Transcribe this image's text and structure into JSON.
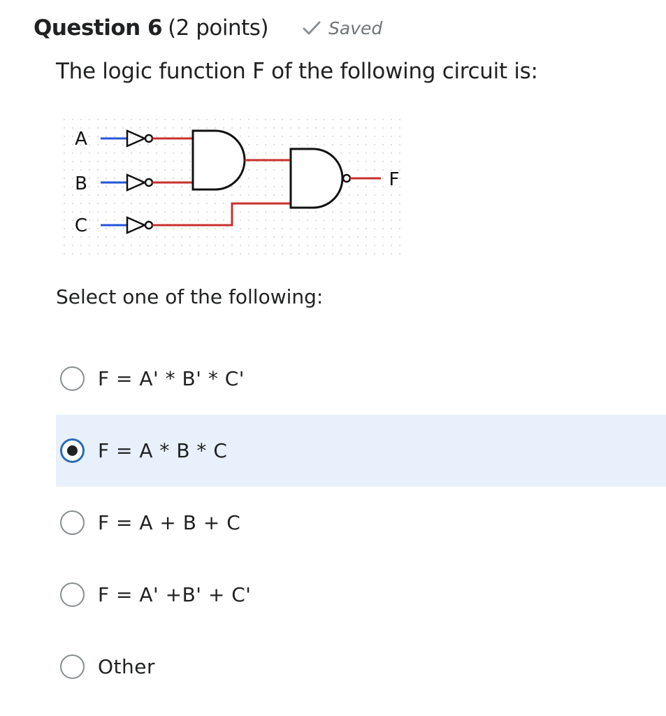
{
  "question": {
    "title": "Question 6",
    "points": "(2 points)",
    "saved_label": "Saved",
    "text": "The logic function F of the following circuit is:"
  },
  "circuit": {
    "inputs": [
      "A",
      "B",
      "C"
    ],
    "output": "F",
    "colors": {
      "input_wire": "#2456d6",
      "output_wire": "#c8302c",
      "gate_stroke": "#111111",
      "grid_dot": "#d2d2d2"
    }
  },
  "prompt": "Select one of the following:",
  "options": [
    {
      "label": "F = A' * B' * C'",
      "selected": false
    },
    {
      "label": "F = A * B * C",
      "selected": true
    },
    {
      "label": "F = A + B + C",
      "selected": false
    },
    {
      "label": "F = A' +B' + C'",
      "selected": false
    },
    {
      "label": "Other",
      "selected": false
    }
  ],
  "colors": {
    "selected_bg": "#e8f1fb",
    "radio_checked_border": "#2a6bb5",
    "saved_check": "#8a9093"
  }
}
